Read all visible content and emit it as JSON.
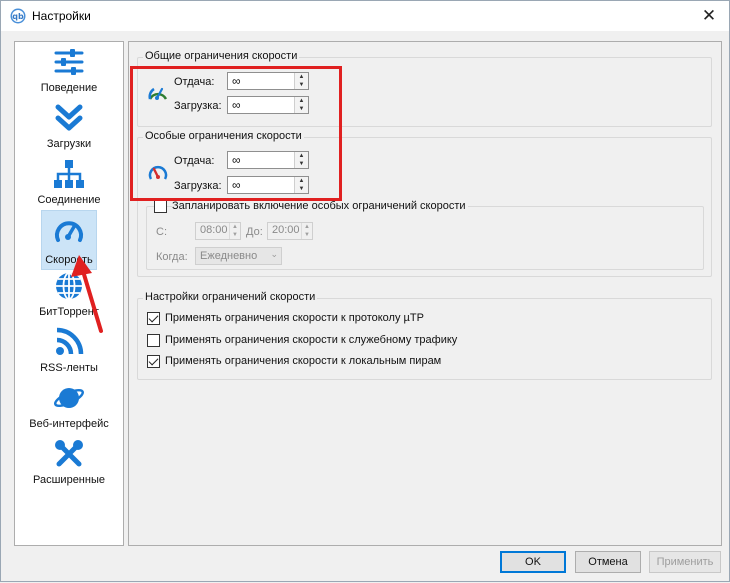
{
  "window": {
    "title": "Настройки",
    "close_glyph": "✕"
  },
  "sidebar": {
    "items": [
      {
        "label": "Поведение",
        "icon": "sliders-icon"
      },
      {
        "label": "Загрузки",
        "icon": "double-chevron-down-icon"
      },
      {
        "label": "Соединение",
        "icon": "network-icon"
      },
      {
        "label": "Скорость",
        "icon": "speedometer-icon",
        "selected": true
      },
      {
        "label": "БитТоррент",
        "icon": "globe-icon"
      },
      {
        "label": "RSS-ленты",
        "icon": "rss-icon"
      },
      {
        "label": "Веб-интерфейс",
        "icon": "planet-icon"
      },
      {
        "label": "Расширенные",
        "icon": "tools-icon"
      }
    ]
  },
  "global_limits": {
    "title": "Общие ограничения скорости",
    "upload_label": "Отдача:",
    "upload_value": "∞",
    "download_label": "Загрузка:",
    "download_value": "∞"
  },
  "alt_limits": {
    "title": "Особые ограничения скорости",
    "upload_label": "Отдача:",
    "upload_value": "∞",
    "download_label": "Загрузка:",
    "download_value": "∞",
    "schedule_label": "Запланировать включение особых ограничений скорости",
    "schedule_checked": false,
    "from_label": "С:",
    "from_value": "08:00",
    "to_label": "До:",
    "to_value": "20:00",
    "when_label": "Когда:",
    "when_value": "Ежедневно"
  },
  "limit_settings": {
    "title": "Настройки ограничений скорости",
    "options": [
      {
        "label": "Применять ограничения скорости к протоколу µTP",
        "checked": true
      },
      {
        "label": "Применять ограничения скорости к служебному трафику",
        "checked": false
      },
      {
        "label": "Применять ограничения скорости к локальным пирам",
        "checked": true
      }
    ]
  },
  "buttons": {
    "ok": "OK",
    "cancel": "Отмена",
    "apply": "Применить"
  },
  "colors": {
    "accent": "#1a7ad4",
    "highlight": "#e02020",
    "selected": "#cce4f7"
  }
}
